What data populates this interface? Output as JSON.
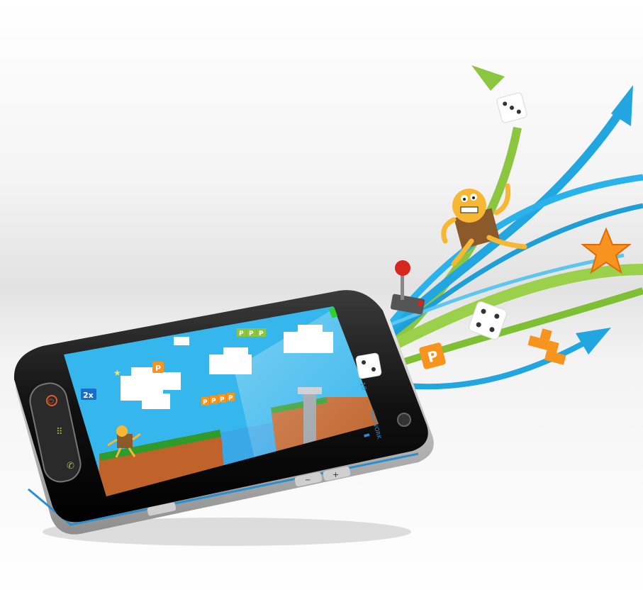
{
  "scene": {
    "colors": {
      "sky": "#35b6ec",
      "brick": "#c0632a",
      "grass": "#2f9b2a",
      "water": "#3aa7e6",
      "ribbon_blue": "#22a6e0",
      "ribbon_green": "#8cc63f",
      "phone_body": "#1a1a1a",
      "orange_block": "#f7941d",
      "star": "#f7931e"
    }
  },
  "game": {
    "multiplier": "2x",
    "p_coin": "P",
    "p_row_top": [
      "P",
      "P",
      "P"
    ],
    "p_row_mid": [
      "P",
      "P",
      "P",
      "P"
    ]
  },
  "phone": {
    "side_text": "NETWORK",
    "side_text_top": "10"
  },
  "icons": [
    "power-icon",
    "keypad-icon",
    "call-icon",
    "minus-icon",
    "plus-icon",
    "camera-icon",
    "battery-icon",
    "signal-icon",
    "joystick-icon",
    "dice-icon",
    "star-icon",
    "arrow-icon"
  ]
}
